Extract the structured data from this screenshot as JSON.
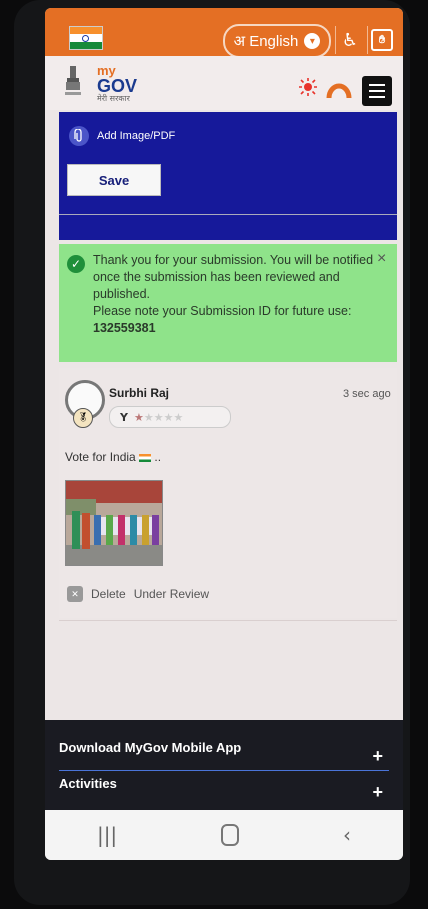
{
  "header": {
    "language_button": "अ English",
    "accessibility_icon": "accessibility-icon",
    "sign_language_icon": "sign-language-icon"
  },
  "brand": {
    "my": "my",
    "gov": "GOV",
    "hindi": "मेरी सरकार"
  },
  "form": {
    "add_file_label": "Add Image/PDF",
    "save_label": "Save"
  },
  "alert": {
    "message": "Thank you for your submission. You will be notified once the submission has been reviewed and published.",
    "note": "Please note your Submission ID for future use:",
    "submission_id": "132559381",
    "close": "×"
  },
  "comment": {
    "user": "Surbhi Raj",
    "time": "3 sec ago",
    "rating_letter": "Y",
    "rating": 1,
    "rating_max": 5,
    "text": "Vote for India",
    "text_suffix": "..",
    "delete_label": "Delete",
    "status": "Under Review"
  },
  "footer": {
    "items": [
      {
        "label": "Download MyGov Mobile App",
        "icon": "+"
      },
      {
        "label": "Activities",
        "icon": "+"
      }
    ]
  },
  "nav": {
    "recent": "|||",
    "back": "‹"
  },
  "colors": {
    "accent_orange": "#e46f24",
    "form_blue": "#16199a",
    "success_green": "#8fe38a"
  }
}
